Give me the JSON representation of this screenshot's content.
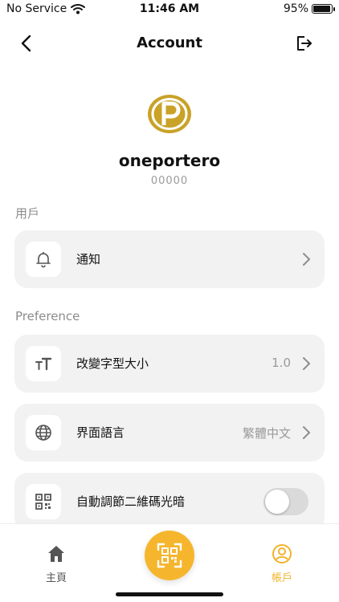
{
  "status_bar": {
    "carrier": "No Service",
    "time": "11:46 AM",
    "battery_percent": "95%",
    "battery_level": 0.95
  },
  "header": {
    "title": "Account",
    "back_icon": "chevron-left-icon",
    "logout_icon": "logout-icon"
  },
  "profile": {
    "name": "oneportero",
    "id": "00000",
    "logo_color": "#c9a227"
  },
  "sections": {
    "user_label": "用戶",
    "preference_label": "Preference"
  },
  "rows": {
    "notifications": {
      "label": "通知",
      "icon": "bell-icon"
    },
    "font_size": {
      "label": "改變字型大小",
      "value": "1.0",
      "icon": "text-size-icon"
    },
    "language": {
      "label": "界面語言",
      "value": "繁體中文",
      "icon": "globe-icon"
    },
    "auto_brightness": {
      "label": "自動調節二維碼光暗",
      "icon": "qr-code-icon",
      "enabled": false
    }
  },
  "tab_bar": {
    "home_label": "主頁",
    "account_label": "帳戶",
    "accent_color": "#f2b32b",
    "scan_icon": "qr-scan-icon"
  }
}
